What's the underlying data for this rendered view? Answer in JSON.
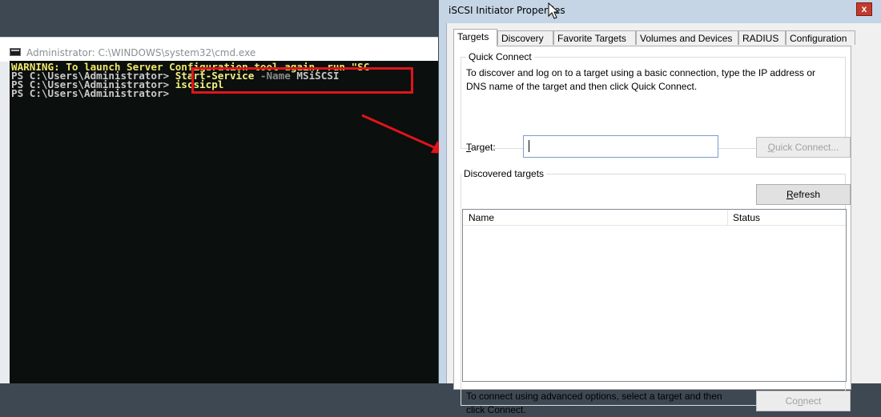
{
  "cmd": {
    "title": "Administrator: C:\\WINDOWS\\system32\\cmd.exe",
    "lines": {
      "warning": "WARNING: To launch Server Configuration tool again, run \"SC",
      "prompt1": "PS C:\\Users\\Administrator> ",
      "cmdlet": "Start-Service",
      "param": "-Name",
      "arg": "MSiSCSI",
      "prompt2": "PS C:\\Users\\Administrator> ",
      "cmd2": "iscsicpl",
      "prompt3": "PS C:\\Users\\Administrator>"
    }
  },
  "dialog": {
    "title": "iSCSI Initiator Properties",
    "close": "x",
    "tabs": [
      "Targets",
      "Discovery",
      "Favorite Targets",
      "Volumes and Devices",
      "RADIUS",
      "Configuration"
    ],
    "quick_connect": {
      "group_label": "Quick Connect",
      "description_line1": "To discover and log on to a target using a basic connection, type the IP address or",
      "description_line2": "DNS name of the target and then click Quick Connect.",
      "target_label_key": "T",
      "target_label_rest": "arget:",
      "target_value": "",
      "button_key": "Q",
      "button_rest": "uick Connect..."
    },
    "discovered": {
      "group_label": "Discovered targets",
      "refresh_key": "R",
      "refresh_rest": "efresh",
      "columns": [
        "Name",
        "Status"
      ],
      "rows": [],
      "footer_text_line1": "To connect using advanced options, select a target and then",
      "footer_text_line2": "click Connect.",
      "connect_pre": "Co",
      "connect_key": "n",
      "connect_post": "nect"
    }
  },
  "colors": {
    "desktop": "#3e4852",
    "console_bg": "#0b0f0d",
    "warning_text": "#f0e86a",
    "highlight_box": "#e0141b",
    "arrow": "#e0141b",
    "dialog_frame": "#c5d5e6"
  }
}
